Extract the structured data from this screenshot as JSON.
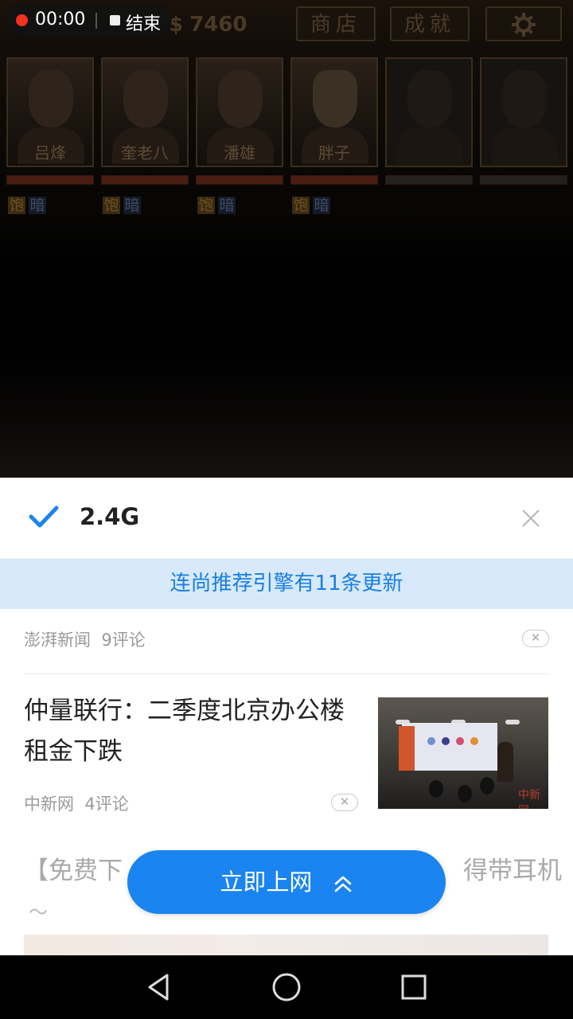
{
  "game": {
    "money_symbol": "$",
    "money": "7460",
    "buttons": [
      "商店",
      "成就"
    ],
    "settings_icon": "gear-icon",
    "characters": [
      {
        "name": "吕烽",
        "status_full": "饱",
        "status_dark": "暗"
      },
      {
        "name": "奎老八",
        "status_full": "饱",
        "status_dark": "暗"
      },
      {
        "name": "潘雄",
        "status_full": "饱",
        "status_dark": "暗"
      },
      {
        "name": "胖子",
        "status_full": "饱",
        "status_dark": "暗"
      }
    ]
  },
  "recording": {
    "time": "00:00",
    "stop_label": "结束",
    "dot_color": "#f2301e"
  },
  "network": {
    "name": "2.4G",
    "check_icon": "check-icon",
    "close_icon": "close-icon",
    "accent": "#1a84f0"
  },
  "banner": {
    "text": "连尚推荐引擎有11条更新"
  },
  "feed": {
    "item1": {
      "source": "澎湃新闻",
      "comments": "9评论"
    },
    "item2": {
      "title": "仲量联行：二季度北京办公楼租金下跌",
      "source": "中新网",
      "comments": "4评论",
      "image_watermark": "中新网"
    },
    "item3": {
      "title_left": "【免费下",
      "title_right": "得带耳机",
      "tilde": "～"
    }
  },
  "cta": {
    "label": "立即上网",
    "icon": "double-chevron-up-icon"
  },
  "navbar": {
    "back_icon": "back-triangle-icon",
    "home_icon": "home-circle-icon",
    "recents_icon": "recents-square-icon"
  }
}
